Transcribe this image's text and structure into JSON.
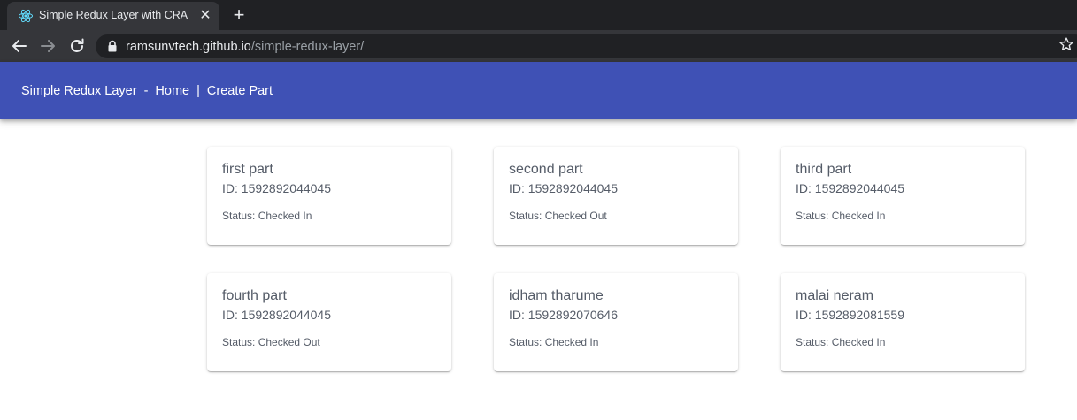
{
  "browser": {
    "tab_title": "Simple Redux Layer with CRA",
    "tab_close": "✕",
    "new_tab": "+",
    "url_host": "ramsunvtech.github.io",
    "url_path": "/simple-redux-layer/"
  },
  "app_bar": {
    "title": "Simple Redux Layer",
    "separator": "-",
    "home_label": "Home",
    "pipe": "|",
    "create_part_label": "Create Part",
    "color": "#3f51b5"
  },
  "parts": [
    {
      "name": "first part",
      "id_text": "ID: 1592892044045",
      "status_text": "Status: Checked In"
    },
    {
      "name": "second part",
      "id_text": "ID: 1592892044045",
      "status_text": "Status: Checked Out"
    },
    {
      "name": "third part",
      "id_text": "ID: 1592892044045",
      "status_text": "Status: Checked In"
    },
    {
      "name": "fourth part",
      "id_text": "ID: 1592892044045",
      "status_text": "Status: Checked Out"
    },
    {
      "name": "idham tharume",
      "id_text": "ID: 1592892070646",
      "status_text": "Status: Checked In"
    },
    {
      "name": "malai neram",
      "id_text": "ID: 1592892081559",
      "status_text": "Status: Checked In"
    }
  ],
  "icons": {
    "favicon": "react-icon",
    "back": "back-arrow-icon",
    "forward": "forward-arrow-icon",
    "reload": "reload-icon",
    "lock": "lock-icon",
    "bookmark": "star-icon"
  }
}
